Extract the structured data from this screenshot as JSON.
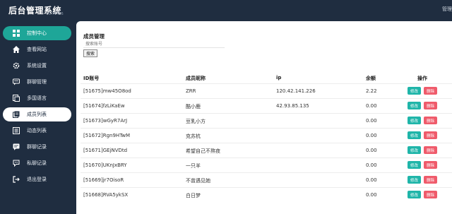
{
  "header": {
    "brand": "后台管理系统",
    "version": "v1.75406",
    "right_text": "管理"
  },
  "sidebar": {
    "items": [
      {
        "label": "控制中心",
        "icon": "grid-icon"
      },
      {
        "label": "查看网站",
        "icon": "home-icon"
      },
      {
        "label": "系统设置",
        "icon": "gear-icon"
      },
      {
        "label": "群聊管理",
        "icon": "chat-icon"
      },
      {
        "label": "多国语言",
        "icon": "language-icon"
      },
      {
        "label": "成员列表",
        "icon": "members-icon"
      },
      {
        "label": "动态列表",
        "icon": "list-icon"
      },
      {
        "label": "群聊记录",
        "icon": "chat-log-icon"
      },
      {
        "label": "私聊记录",
        "icon": "private-chat-icon"
      },
      {
        "label": "退出登录",
        "icon": "logout-icon"
      }
    ]
  },
  "main": {
    "title": "成员管理",
    "search_placeholder": "搜索账号",
    "search_button": "搜索",
    "columns": [
      "ID账号",
      "成员昵称",
      "ip",
      "余额",
      "操作"
    ],
    "edit_label": "修改",
    "delete_label": "删除",
    "rows": [
      {
        "id": "[51675]mw45O8od",
        "nick": "ZRR",
        "ip": "120.42.141.226",
        "balance": "2.22"
      },
      {
        "id": "[51674]fzLiKaEw",
        "nick": "酷小鹿",
        "ip": "42.93.85.135",
        "balance": "0.00"
      },
      {
        "id": "[51673]wGyR7ArJ",
        "nick": "豆乳小方",
        "ip": "",
        "balance": "0.00"
      },
      {
        "id": "[51672]Rgn9HTwM",
        "nick": "克苏杭",
        "ip": "",
        "balance": "0.00"
      },
      {
        "id": "[51671]GEjNVDtd",
        "nick": "希望自己不熬夜",
        "ip": "",
        "balance": "0.00"
      },
      {
        "id": "[51670]UKnJxBRY",
        "nick": "一只羊",
        "ip": "",
        "balance": "0.00"
      },
      {
        "id": "[51669]jr7OisoR",
        "nick": "不曾遇见她",
        "ip": "",
        "balance": "0.00"
      },
      {
        "id": "[51668]RVA5ykSX",
        "nick": "白日梦",
        "ip": "",
        "balance": "0.00"
      }
    ]
  }
}
